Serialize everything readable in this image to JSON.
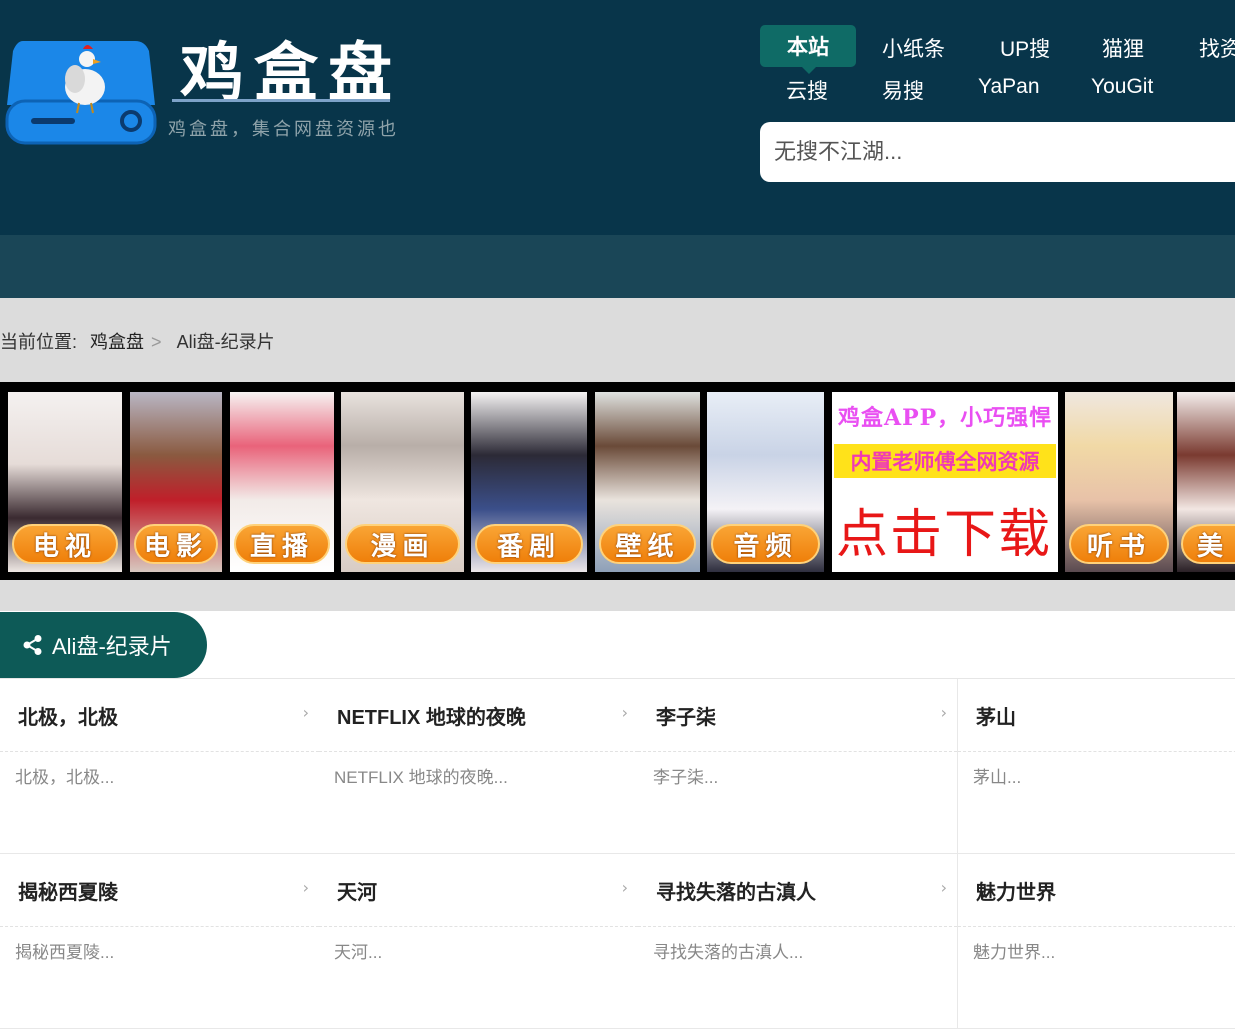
{
  "header": {
    "site_title": "鸡盒盘",
    "tagline": "鸡盒盘，集合网盘资源也",
    "nav": {
      "active": "本站",
      "row1": [
        "小纸条",
        "UP搜",
        "猫狸",
        "找资"
      ],
      "row2": [
        "云搜",
        "易搜",
        "YaPan",
        "YouGit"
      ]
    },
    "search_placeholder": "无搜不江湖..."
  },
  "breadcrumb": {
    "prefix": "当前位置:",
    "home": "鸡盒盘",
    "separator": ">",
    "current": "Ali盘-纪录片"
  },
  "banner": {
    "tiles": [
      "电视",
      "电影",
      "直播",
      "漫画",
      "番剧",
      "壁纸",
      "音频",
      "听书",
      "美"
    ],
    "ad": {
      "line1": "鸡盒APP，小巧强悍",
      "line2": "内置老师傅全网资源",
      "line3": "点击下载"
    }
  },
  "section": {
    "title": "Ali盘-纪录片"
  },
  "cards": [
    {
      "title": "北极，北极",
      "desc": "北极，北极..."
    },
    {
      "title": "NETFLIX 地球的夜晚",
      "desc": "NETFLIX 地球的夜晚..."
    },
    {
      "title": "李子柒",
      "desc": "李子柒..."
    },
    {
      "title": "茅山",
      "desc": "茅山..."
    },
    {
      "title": "揭秘西夏陵",
      "desc": "揭秘西夏陵..."
    },
    {
      "title": "天河",
      "desc": "天河..."
    },
    {
      "title": "寻找失落的古滇人",
      "desc": "寻找失落的古滇人..."
    },
    {
      "title": "魅力世界",
      "desc": "魅力世界..."
    }
  ],
  "colors": {
    "header_bg": "#08354a",
    "accent": "#0d5a57",
    "pill_orange": "#ef7f0a"
  }
}
